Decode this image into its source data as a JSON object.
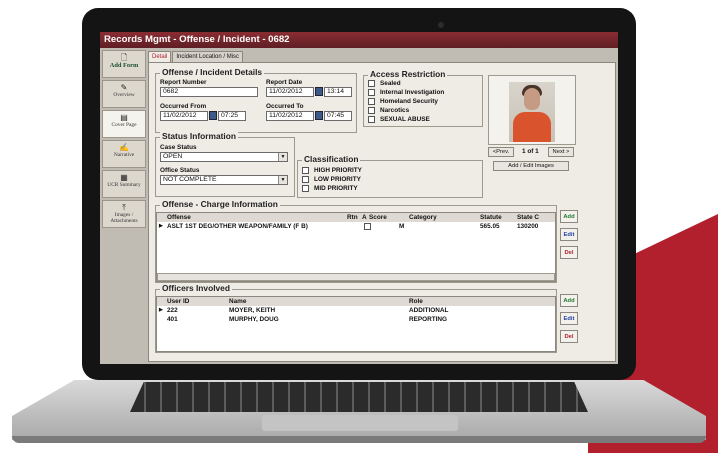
{
  "window": {
    "title": "Records Mgmt - Offense / Incident - 0682"
  },
  "sidebar": {
    "items": [
      {
        "label": "Add Form",
        "icon": "add-form-icon"
      },
      {
        "label": "Overview",
        "icon": "overview-icon"
      },
      {
        "label": "Cover Page",
        "icon": "cover-page-icon"
      },
      {
        "label": "Narrative",
        "icon": "narrative-icon"
      },
      {
        "label": "UCR Summary",
        "icon": "ucr-summary-icon"
      },
      {
        "label": "Images / Attachments",
        "icon": "images-icon"
      }
    ]
  },
  "tabs": [
    "Detail",
    "Incident Location / Misc"
  ],
  "details": {
    "title": "Offense / Incident Details",
    "report_number_label": "Report Number",
    "report_number": "0682",
    "report_date_label": "Report Date",
    "report_date": "11/02/2012",
    "report_time": "13:14",
    "occurred_from_label": "Occurred From",
    "occurred_from_date": "11/02/2012",
    "occurred_from_time": "07:25",
    "occurred_to_label": "Occurred To",
    "occurred_to_date": "11/02/2012",
    "occurred_to_time": "07:45"
  },
  "access": {
    "title": "Access Restriction",
    "options": [
      "Sealed",
      "Internal Investigation",
      "Homeland Security",
      "Narcotics",
      "SEXUAL ABUSE"
    ]
  },
  "status": {
    "title": "Status Information",
    "case_status_label": "Case Status",
    "case_status": "OPEN",
    "office_status_label": "Office Status",
    "office_status": "NOT COMPLETE"
  },
  "classification": {
    "title": "Classification",
    "options": [
      "HIGH PRIORITY",
      "LOW PRIORITY",
      "MID PRIORITY"
    ]
  },
  "images": {
    "prev": "<Prev.",
    "counter": "1 of 1",
    "next": "Next >",
    "edit": "Add / Edit Images"
  },
  "charges": {
    "title": "Offense - Charge Information",
    "columns": [
      "Offense",
      "Rtn",
      "A",
      "Score",
      "Category",
      "Statute",
      "State C"
    ],
    "rows": [
      {
        "offense": "ASLT 1ST DEG/OTHER WEAPON/FAMILY (F B)",
        "category": "M",
        "statute": "565.05",
        "state_code": "130200"
      }
    ]
  },
  "officers": {
    "title": "Officers Involved",
    "columns": [
      "User ID",
      "Name",
      "Role"
    ],
    "rows": [
      {
        "user_id": "222",
        "name": "MOYER, KEITH",
        "role": "ADDITIONAL"
      },
      {
        "user_id": "401",
        "name": "MURPHY, DOUG",
        "role": "REPORTING"
      }
    ]
  },
  "buttons": {
    "add": "Add",
    "edit": "Edit",
    "delete": "Del"
  },
  "colors": {
    "accent": "#b3202d",
    "titlebar": "#6e2328",
    "add": "#1f7a2b",
    "edit": "#2742a0"
  }
}
